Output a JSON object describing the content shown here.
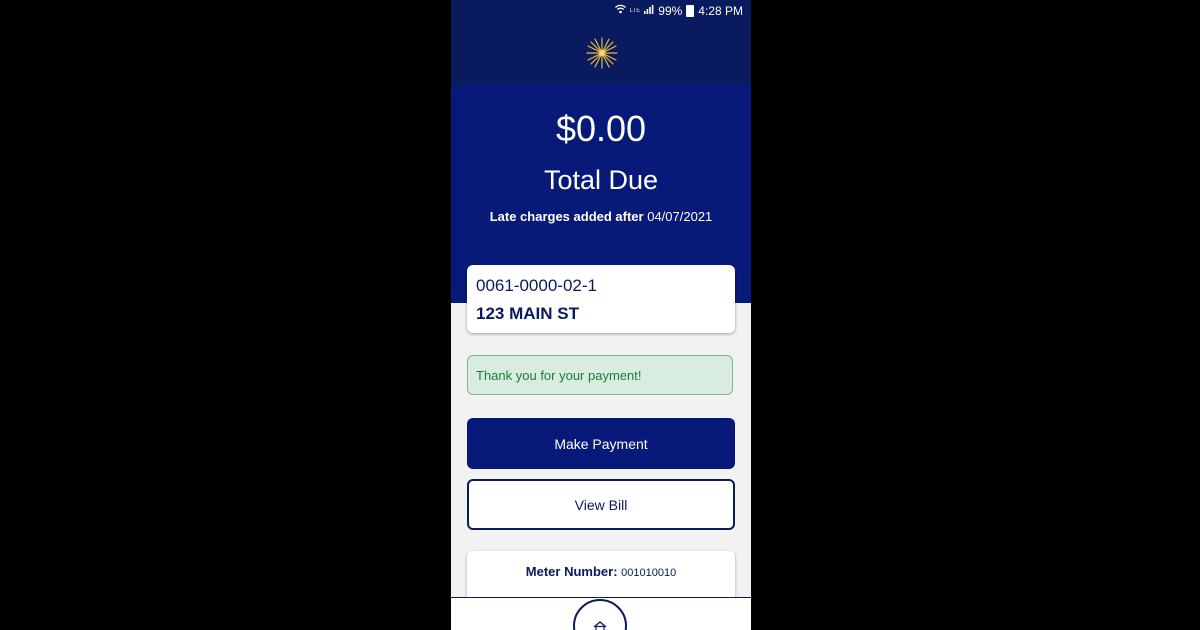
{
  "status_bar": {
    "lte": "LTE",
    "battery": "99%",
    "time": "4:28 PM"
  },
  "hero": {
    "amount": "$0.00",
    "label": "Total Due",
    "late_label": "Late charges added after",
    "late_date": "04/07/2021"
  },
  "account": {
    "number": "0061-0000-02-1",
    "address": "123 MAIN ST"
  },
  "notice": {
    "message": "Thank you for your payment!"
  },
  "buttons": {
    "make_payment": "Make Payment",
    "view_bill": "View Bill"
  },
  "meter": {
    "label": "Meter Number:",
    "value": "001010010"
  },
  "bottom_nav": {
    "icons": [
      "chevron-left-icon",
      "chevron-left-icon",
      "home-icon",
      "chevron-right-icon",
      "chevron-right-icon"
    ]
  },
  "colors": {
    "navy": "#0a1a5e",
    "hero_blue": "#071a79",
    "success_bg": "#d8ede0",
    "success_text": "#1f7a3a",
    "star_gold": "#e8b93a"
  }
}
